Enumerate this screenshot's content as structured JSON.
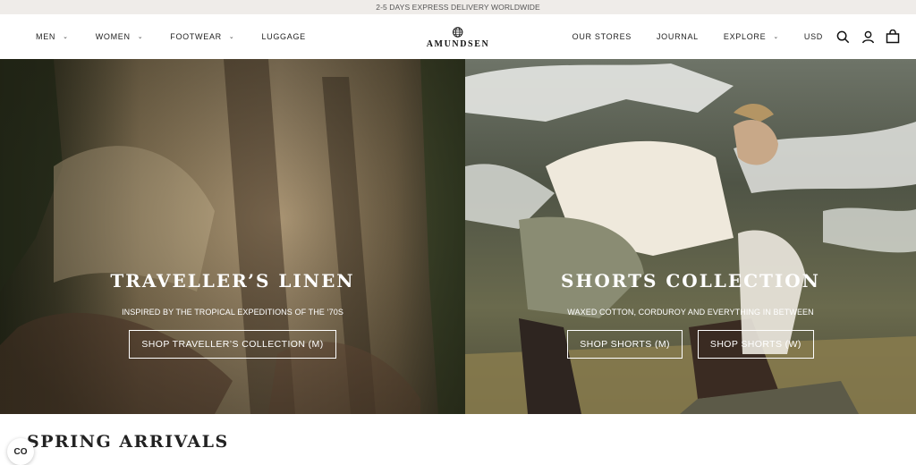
{
  "announcement": "2-5 DAYS EXPRESS DELIVERY WORLDWIDE",
  "nav_left": [
    {
      "label": "MEN",
      "dropdown": true
    },
    {
      "label": "WOMEN",
      "dropdown": true
    },
    {
      "label": "FOOTWEAR",
      "dropdown": true
    },
    {
      "label": "LUGGAGE",
      "dropdown": false
    }
  ],
  "logo": "AMUNDSEN",
  "nav_right": [
    {
      "label": "OUR STORES",
      "dropdown": false
    },
    {
      "label": "JOURNAL",
      "dropdown": false
    },
    {
      "label": "EXPLORE",
      "dropdown": true
    }
  ],
  "currency": "USD",
  "icons": [
    "search-icon",
    "account-icon",
    "cart-icon"
  ],
  "hero_left": {
    "title": "TRAVELLER’S LINEN",
    "subtitle": "INSPIRED BY THE TROPICAL EXPEDITIONS OF THE ’70S",
    "buttons": [
      "SHOP TRAVELLER’S COLLECTION (M)"
    ]
  },
  "hero_right": {
    "title": "SHORTS COLLECTION",
    "subtitle": "WAXED COTTON, CORDUROY AND EVERYTHING IN BETWEEN",
    "buttons": [
      "SHOP SHORTS (M)",
      "SHOP SHORTS (W)"
    ]
  },
  "section_title": "SPRING ARRIVALS",
  "cookie_label": "CO"
}
